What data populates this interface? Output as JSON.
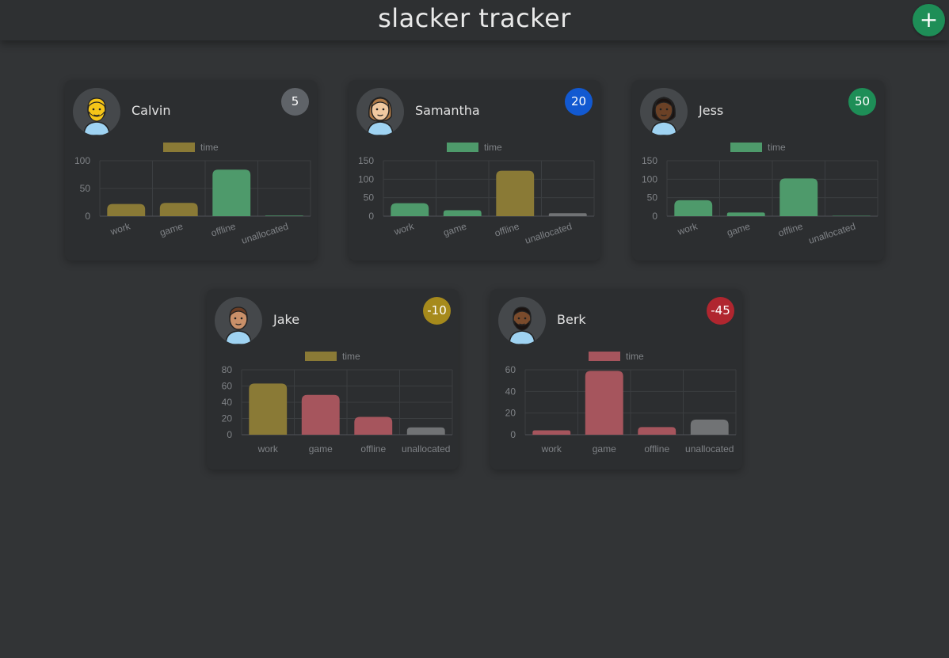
{
  "header": {
    "title": "slacker tracker",
    "add_label": "+"
  },
  "colors": {
    "background": "#323436",
    "card": "#2c2e30",
    "olive": "#8a7a36",
    "green": "#4e9a6b",
    "rose": "#a6555d",
    "grey": "#717375"
  },
  "cards": [
    {
      "name": "Calvin",
      "score": "5",
      "badge_color": "#5f6368",
      "avatar": "yellow-person-icon",
      "chart_data": {
        "type": "bar",
        "legend": "time",
        "legend_color": "#8a7a36",
        "categories": [
          "work",
          "game",
          "offline",
          "unallocated"
        ],
        "values": [
          22,
          24,
          84,
          1
        ],
        "ylim": [
          0,
          100
        ],
        "yticks": [
          0,
          50,
          100
        ],
        "colors": [
          "#8a7a36",
          "#8a7a36",
          "#4e9a6b",
          "#4e9a6b"
        ],
        "rotate_labels": true
      }
    },
    {
      "name": "Samantha",
      "score": "20",
      "badge_color": "#1259d1",
      "avatar": "woman-light-icon",
      "chart_data": {
        "type": "bar",
        "legend": "time",
        "legend_color": "#4e9a6b",
        "categories": [
          "work",
          "game",
          "offline",
          "unallocated"
        ],
        "values": [
          35,
          16,
          123,
          8
        ],
        "ylim": [
          0,
          150
        ],
        "yticks": [
          0,
          50,
          100,
          150
        ],
        "colors": [
          "#4e9a6b",
          "#4e9a6b",
          "#8a7a36",
          "#717375"
        ],
        "rotate_labels": true
      }
    },
    {
      "name": "Jess",
      "score": "50",
      "badge_color": "#1e8e57",
      "avatar": "woman-dark-icon",
      "chart_data": {
        "type": "bar",
        "legend": "time",
        "legend_color": "#4e9a6b",
        "categories": [
          "work",
          "game",
          "offline",
          "unallocated"
        ],
        "values": [
          43,
          10,
          102,
          1
        ],
        "ylim": [
          0,
          150
        ],
        "yticks": [
          0,
          50,
          100,
          150
        ],
        "colors": [
          "#4e9a6b",
          "#4e9a6b",
          "#4e9a6b",
          "#4e9a6b"
        ],
        "rotate_labels": true
      }
    },
    {
      "name": "Jake",
      "score": "-10",
      "badge_color": "#a68a1c",
      "avatar": "man-medium-icon",
      "chart_data": {
        "type": "bar",
        "legend": "time",
        "legend_color": "#8a7a36",
        "categories": [
          "work",
          "game",
          "offline",
          "unallocated"
        ],
        "values": [
          63,
          49,
          22,
          9
        ],
        "ylim": [
          0,
          80
        ],
        "yticks": [
          0,
          20,
          40,
          60,
          80
        ],
        "colors": [
          "#8a7a36",
          "#a6555d",
          "#a6555d",
          "#717375"
        ],
        "rotate_labels": false
      }
    },
    {
      "name": "Berk",
      "score": "-45",
      "badge_color": "#b0262f",
      "avatar": "man-dark-icon",
      "chart_data": {
        "type": "bar",
        "legend": "time",
        "legend_color": "#a6555d",
        "categories": [
          "work",
          "game",
          "offline",
          "unallocated"
        ],
        "values": [
          4,
          59,
          7,
          14
        ],
        "ylim": [
          0,
          60
        ],
        "yticks": [
          0,
          20,
          40,
          60
        ],
        "colors": [
          "#a6555d",
          "#a6555d",
          "#a6555d",
          "#717375"
        ],
        "rotate_labels": false
      }
    }
  ]
}
